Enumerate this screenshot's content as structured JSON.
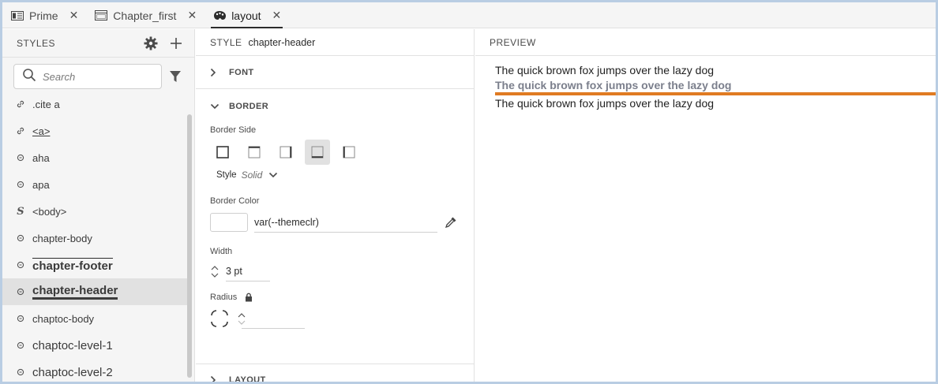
{
  "tabs": [
    {
      "label": "Prime",
      "icon": "document-icon"
    },
    {
      "label": "Chapter_first",
      "icon": "layout-icon"
    },
    {
      "label": "layout",
      "icon": "palette-icon",
      "active": true
    }
  ],
  "sidebar": {
    "title": "STYLES",
    "search_placeholder": "Search",
    "items": [
      {
        "label": ".cite a",
        "icon": "link-icon"
      },
      {
        "label": "<a>",
        "icon": "link-icon"
      },
      {
        "label": "aha",
        "icon": "style-class-icon"
      },
      {
        "label": "apa",
        "icon": "style-class-icon"
      },
      {
        "label": "<body>",
        "icon": "element-s-icon"
      },
      {
        "label": "chapter-body",
        "icon": "style-class-icon"
      },
      {
        "label": "chapter-footer",
        "icon": "style-class-icon"
      },
      {
        "label": "chapter-header",
        "icon": "style-class-icon",
        "selected": true
      },
      {
        "label": "chaptoc-body",
        "icon": "style-class-icon"
      },
      {
        "label": "chaptoc-level-1",
        "icon": "style-class-icon"
      },
      {
        "label": "chaptoc-level-2",
        "icon": "style-class-icon"
      }
    ]
  },
  "editor": {
    "style_key": "STYLE",
    "style_name": "chapter-header",
    "font_label": "FONT",
    "border_label": "BORDER",
    "border_side_label": "Border Side",
    "style_label": "Style",
    "style_value": "Solid",
    "border_color_label": "Border Color",
    "border_color_value": "var(--themeclr)",
    "width_label": "Width",
    "width_value": "3 pt",
    "radius_label": "Radius",
    "layout_label": "LAYOUT"
  },
  "preview": {
    "title": "PREVIEW",
    "line1": "The quick brown fox jumps over the lazy dog",
    "line2": "The quick brown fox jumps over the lazy dog",
    "line3": "The quick brown fox jumps over the lazy dog",
    "rule_color": "#e07b22"
  },
  "colors": {
    "accent": "#e07b22",
    "header_text": "#7b7f8c",
    "frame": "#b9cde3"
  }
}
